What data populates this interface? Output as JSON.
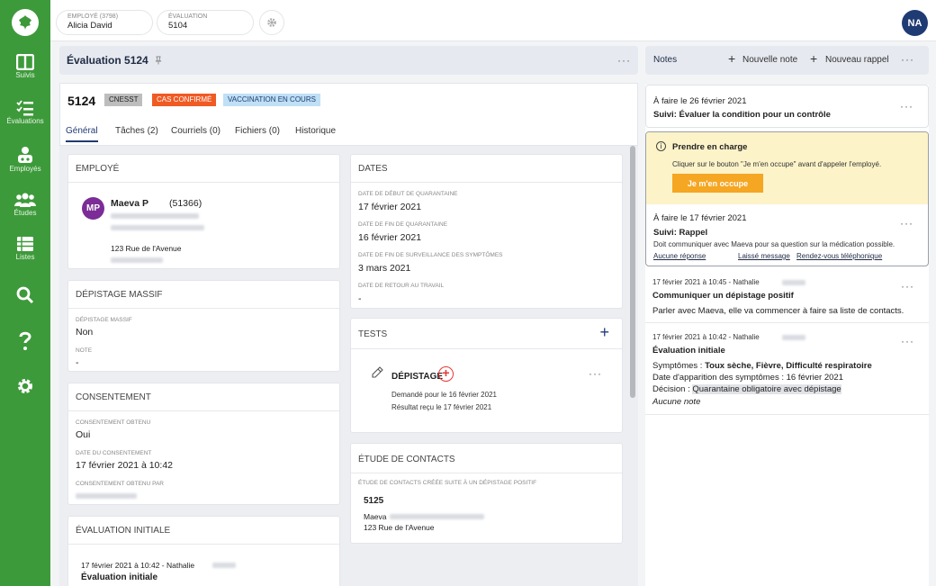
{
  "sidebar": {
    "items": [
      {
        "label": "Suivis",
        "icon": "board-icon"
      },
      {
        "label": "Évaluations",
        "icon": "checklist-icon"
      },
      {
        "label": "Employés",
        "icon": "employee-icon"
      },
      {
        "label": "Études",
        "icon": "group-icon"
      },
      {
        "label": "Listes",
        "icon": "list-icon"
      },
      {
        "label": "",
        "icon": "search-icon"
      },
      {
        "label": "",
        "icon": "help-icon"
      },
      {
        "label": "",
        "icon": "gear-icon"
      }
    ]
  },
  "topbar": {
    "employee_label": "EMPLOYÉ (3798)",
    "employee_value": "Alicia David",
    "evaluation_label": "ÉVALUATION",
    "evaluation_value": "5104",
    "avatar_initials": "NA"
  },
  "eval_header": {
    "title": "Évaluation 5124"
  },
  "case": {
    "number": "5124",
    "badges": [
      {
        "label": "CNESST",
        "bg": "#bdbdbd",
        "color": "#222"
      },
      {
        "label": "CAS CONFIRMÉ",
        "bg": "#f05a23",
        "color": "#fff"
      },
      {
        "label": "VACCINATION EN COURS",
        "bg": "#bfe0f5",
        "color": "#1f3b73"
      }
    ],
    "tabs": [
      "Général",
      "Tâches (2)",
      "Courriels (0)",
      "Fichiers (0)",
      "Historique"
    ]
  },
  "employe": {
    "title": "EMPLOYÉ",
    "avatar": "MP",
    "name": "Maeva P",
    "id": "(51366)",
    "address": "123 Rue de l'Avenue"
  },
  "depistage_massif": {
    "title": "DÉPISTAGE MASSIF",
    "field_label": "DÉPISTAGE MASSIF",
    "field_value": "Non",
    "note_label": "NOTE",
    "note_value": "-"
  },
  "consentement": {
    "title": "CONSENTEMENT",
    "obtenu_label": "CONSENTEMENT OBTENU",
    "obtenu_value": "Oui",
    "date_label": "DATE DU CONSENTEMENT",
    "date_value": "17 février 2021 à 10:42",
    "par_label": "CONSENTEMENT OBTENU PAR"
  },
  "evaluation_initiale": {
    "title": "ÉVALUATION INITIALE",
    "meta": "17 février 2021 à 10:42 - Nathalie",
    "name": "Évaluation initiale"
  },
  "dates": {
    "title": "DATES",
    "debut_label": "DATE DE DÉBUT DE QUARANTAINE",
    "debut_value": "17 février 2021",
    "fin_label": "DATE DE FIN DE QUARANTAINE",
    "fin_value": "16 février 2021",
    "surv_label": "DATE DE FIN DE SURVEILLANCE DES SYMPTÔMES",
    "surv_value": "3 mars 2021",
    "retour_label": "DATE DE RETOUR AU TRAVAIL",
    "retour_value": "-"
  },
  "tests": {
    "title": "TESTS",
    "test_name": "DÉPISTAGE",
    "demande": "Demandé pour le 16 février 2021",
    "resultat": "Résultat reçu le 17 février 2021"
  },
  "etude": {
    "title": "ÉTUDE DE CONTACTS",
    "desc": "ÉTUDE DE CONTACTS CRÉÉE SUITE À UN DÉPISTAGE POSITIF",
    "number": "5125",
    "name": "Maeva",
    "address": "123 Rue de l'Avenue"
  },
  "notes": {
    "title": "Notes",
    "new_note": "Nouvelle note",
    "new_reminder": "Nouveau rappel",
    "items": [
      {
        "title": "À faire le 26 février 2021",
        "subtitle": "Suivi: Évaluer la condition pour un contrôle"
      },
      {
        "alert_title": "Prendre en charge",
        "alert_text": "Cliquer sur le bouton \"Je m'en occupe\" avant d'appeler l'employé.",
        "button": "Je m'en occupe",
        "title": "À faire le 17 février 2021",
        "subtitle": "Suivi: Rappel",
        "text": "Doit communiquer avec Maeva pour sa question sur la médication possible.",
        "links": [
          "Aucune réponse",
          "Laissé message",
          "Rendez-vous téléphonique"
        ]
      },
      {
        "meta": "17 février 2021 à 10:45 - Nathalie",
        "title": "Communiquer un dépistage positif",
        "text": "Parler avec Maeva, elle va commencer à faire sa liste de contacts."
      },
      {
        "meta": "17 février 2021 à 10:42 - Nathalie",
        "title": "Évaluation initiale",
        "symptomes_label": "Symptômes : ",
        "symptomes_value": "Toux sèche, Fièvre, Difficulté respiratoire",
        "apparition": "Date d'apparition des symptômes : 16 février 2021",
        "decision_label": "Décision : ",
        "decision_value": "Quarantaine obligatoire avec dépistage",
        "note": "Aucune note"
      }
    ]
  }
}
